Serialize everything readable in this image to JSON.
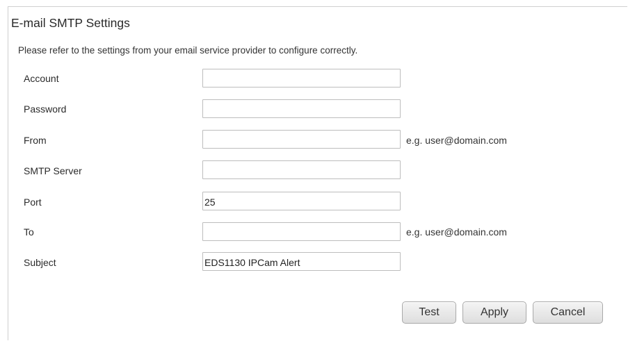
{
  "title": "E-mail SMTP Settings",
  "description": "Please refer to the settings from your email service provider to configure correctly.",
  "fields": {
    "account": {
      "label": "Account",
      "value": ""
    },
    "password": {
      "label": "Password",
      "value": ""
    },
    "from": {
      "label": "From",
      "value": "",
      "hint": "e.g. user@domain.com"
    },
    "smtp_server": {
      "label": "SMTP Server",
      "value": ""
    },
    "port": {
      "label": "Port",
      "value": "25"
    },
    "to": {
      "label": "To",
      "value": "",
      "hint": "e.g. user@domain.com"
    },
    "subject": {
      "label": "Subject",
      "value": "EDS1130 IPCam Alert"
    }
  },
  "buttons": {
    "test": "Test",
    "apply": "Apply",
    "cancel": "Cancel"
  }
}
